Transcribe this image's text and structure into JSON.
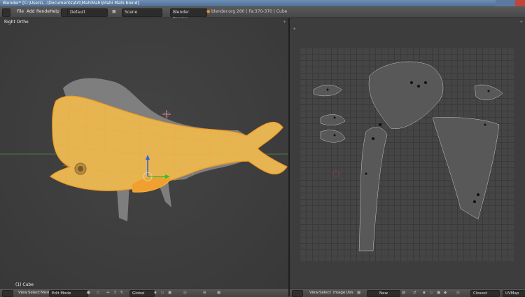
{
  "window": {
    "title": "Blender* [C:\\Users\\...\\Documents\\Art\\MahiMahi\\Mahi Mahi.blend]"
  },
  "topbar": {
    "menus": [
      "File",
      "Add",
      "Render",
      "Help"
    ],
    "screen": "Default",
    "scene": "Scene",
    "engine": "Blender Render",
    "info": "blender.org 260 | Fa:370-370 | Cube"
  },
  "viewport3d": {
    "view_label": "Right Ortho",
    "object_label": "(1) Cube",
    "header": {
      "view": "View",
      "select": "Select",
      "mesh": "Mesh",
      "mode": "Edit Mode",
      "orientation": "Global"
    }
  },
  "uv_editor": {
    "header": {
      "view": "View",
      "select": "Select",
      "image": "Image",
      "uvs": "UVs",
      "new": "New",
      "pivot": "Closest",
      "uvmap": "UVMap"
    }
  },
  "colors": {
    "accent": "#f0a020",
    "mesh": "#e8b048",
    "background": "#3d3d3d"
  }
}
